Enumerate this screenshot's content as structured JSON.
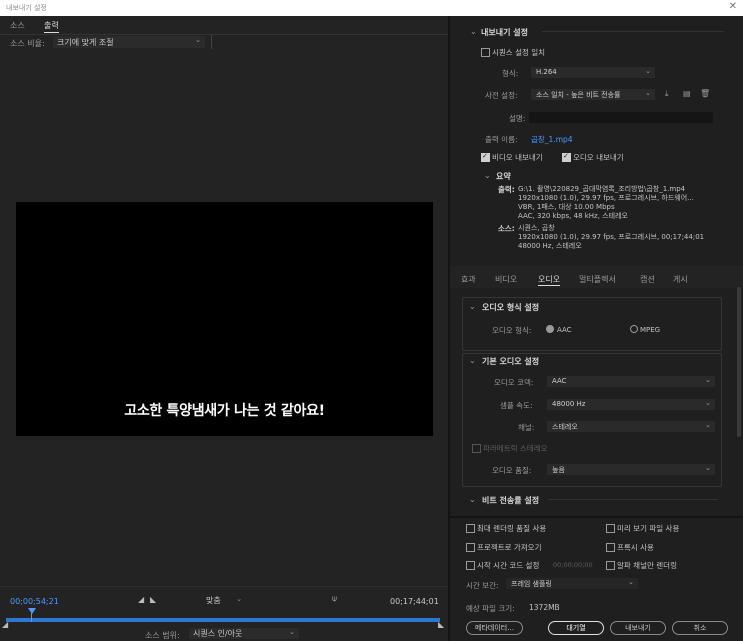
{
  "window": {
    "title": "내보내기 설정",
    "close": "✕"
  },
  "left": {
    "tabs": [
      "소스",
      "출력"
    ],
    "source_scale_label": "소스 비율:",
    "source_scale_value": "크기에 맞게 조절",
    "subtitle": "고소한 특양냄새가 나는 것 같아요!",
    "timecode_current": "00;00;54;21",
    "timecode_end": "00;17;44;01",
    "fit_value": "맞춤",
    "source_range_label": "소스 범위:",
    "source_range_value": "시퀀스 인/아웃"
  },
  "right": {
    "export_settings": {
      "title": "내보내기 설정",
      "match_sequence": "시퀀스 설정 일치",
      "format_label": "형식:",
      "format_value": "H.264",
      "preset_label": "사전 설정:",
      "preset_value": "소스 일치 - 높은 비트 전송률",
      "comment_label": "설명:",
      "output_name_label": "출력 이름:",
      "output_name_value": "곱창_1.mp4",
      "export_video": "비디오 내보내기",
      "export_audio": "오디오 내보내기"
    },
    "summary": {
      "title": "요약",
      "output_label": "출력:",
      "output_lines": [
        "G:\\1. 촬영\\220829_곱대막염록_조리방법\\곱창_1.mp4",
        "1920x1080 (1.0), 29.97 fps, 프로그레시브, 하드웨어...",
        "VBR, 1패스, 대상 10.00 Mbps",
        "AAC, 320 kbps, 48 kHz, 스테레오"
      ],
      "source_label": "소스:",
      "source_lines": [
        "시퀀스, 곱창",
        "1920x1080 (1.0), 29.97 fps, 프로그레시브, 00;17;44;01",
        "48000 Hz, 스테레오"
      ]
    },
    "tabs": [
      "효과",
      "비디오",
      "오디오",
      "멀티플렉서",
      "캡션",
      "게시"
    ],
    "audio_format": {
      "title": "오디오 형식 설정",
      "label": "오디오 형식:",
      "opt_aac": "AAC",
      "opt_mpeg": "MPEG"
    },
    "basic_audio": {
      "title": "기본 오디오 설정",
      "codec_label": "오디오 코덱:",
      "codec_value": "AAC",
      "sample_rate_label": "샘플 속도:",
      "sample_rate_value": "48000 Hz",
      "channels_label": "채널:",
      "channels_value": "스테레오",
      "parametric_stereo": "파라메트릭 스테레오",
      "quality_label": "오디오 품질:",
      "quality_value": "높음"
    },
    "bitrate": {
      "title": "비트 전송률 설정"
    },
    "options": {
      "max_render": "최대 렌더링 품질 사용",
      "use_previews": "미리 보기 파일 사용",
      "import_project": "프로젝트로 가져오기",
      "use_proxy": "프록시 사용",
      "set_start_tc": "시작 시간 코드 설정",
      "start_tc_value": "00;00;00;00",
      "alpha_only": "알파 채널만 렌더링",
      "time_interp_label": "시간 보간:",
      "time_interp_value": "프레임 샘플링",
      "file_size_label": "예상 파일 크기:",
      "file_size_value": "1372MB"
    },
    "buttons": {
      "metadata": "메타데이터...",
      "queue": "대기열",
      "export": "내보내기",
      "cancel": "취소"
    }
  }
}
